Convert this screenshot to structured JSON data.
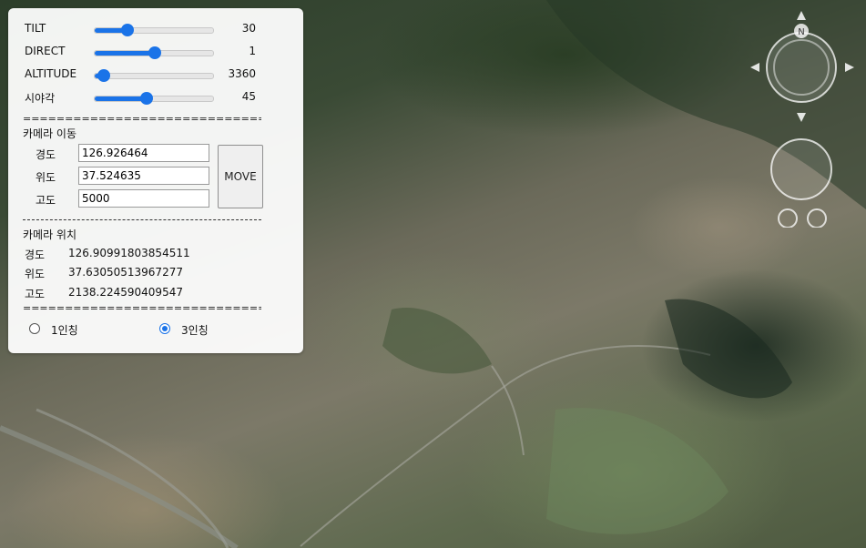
{
  "sliders": [
    {
      "label": "TILT",
      "value": "30",
      "fraction": 0.28
    },
    {
      "label": "DIRECT",
      "value": "1",
      "fraction": 0.51
    },
    {
      "label": "ALTITUDE",
      "value": "3360",
      "fraction": 0.08
    },
    {
      "label": "시야각",
      "value": "45",
      "fraction": 0.44
    }
  ],
  "separator_double": "=============================",
  "move_section": {
    "title": "카메라 이동",
    "longitude_label": "경도",
    "longitude_value": "126.926464",
    "latitude_label": "위도",
    "latitude_value": "37.524635",
    "altitude_label": "고도",
    "altitude_value": "5000",
    "move_button": "MOVE"
  },
  "position_section": {
    "title": "카메라 위치",
    "longitude_label": "경도",
    "longitude_value": "126.90991803854511",
    "latitude_label": "위도",
    "latitude_value": "37.63050513967277",
    "altitude_label": "고도",
    "altitude_value": "2138.224590409547"
  },
  "view_mode": {
    "options": [
      {
        "label": "1인칭",
        "checked": false
      },
      {
        "label": "3인칭",
        "checked": true
      }
    ]
  },
  "compass": {
    "north_label": "N"
  },
  "colors": {
    "accent": "#1a73e8"
  }
}
